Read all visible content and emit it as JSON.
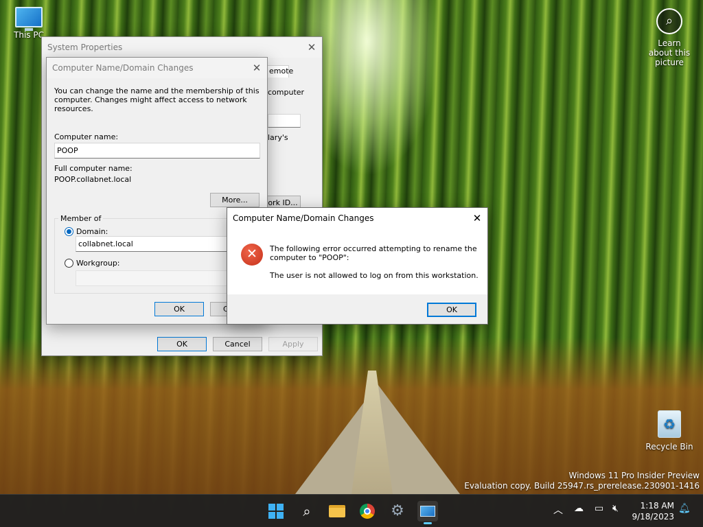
{
  "desktop": {
    "this_pc_label": "This PC",
    "recycle_bin_label": "Recycle Bin",
    "learn_picture_label": "Learn about this picture",
    "watermark_line1": "Windows 11 Pro Insider Preview",
    "watermark_line2": "Evaluation copy. Build 25947.rs_prerelease.230901-1416"
  },
  "system_properties": {
    "title": "System Properties",
    "partial_tab": "emote",
    "partial_text1": "computer",
    "partial_text2": "lary's",
    "partial_button": "ork ID...",
    "ok_label": "OK",
    "cancel_label": "Cancel",
    "apply_label": "Apply"
  },
  "name_changes": {
    "title": "Computer Name/Domain Changes",
    "description": "You can change the name and the membership of this computer. Changes might affect access to network resources.",
    "computer_name_label": "Computer name:",
    "computer_name_value": "POOP",
    "full_name_label": "Full computer name:",
    "full_name_value": "POOP.collabnet.local",
    "more_label": "More...",
    "member_of_label": "Member of",
    "domain_label": "Domain:",
    "domain_value": "collabnet.local",
    "workgroup_label": "Workgroup:",
    "workgroup_value": "",
    "ok_label": "OK",
    "cancel_partial": "C"
  },
  "error_dialog": {
    "title": "Computer Name/Domain Changes",
    "message_line1": "The following error occurred attempting to rename the",
    "message_line2": "computer to \"POOP\":",
    "message_detail": "The user is not allowed to log on from this workstation.",
    "ok_label": "OK"
  },
  "taskbar": {
    "time": "1:18 AM",
    "date": "9/18/2023",
    "icons": [
      "windows-start-icon",
      "search-icon",
      "file-explorer-icon",
      "chrome-icon",
      "settings-gear-icon",
      "system-properties-icon"
    ]
  },
  "colors": {
    "accent": "#0078d7",
    "error_red": "#c5311a",
    "taskbar_bg": "#202020"
  }
}
